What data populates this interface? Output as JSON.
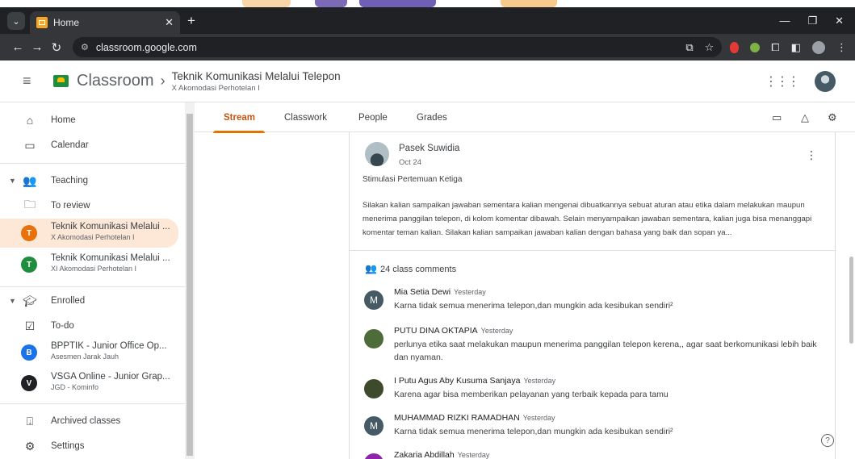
{
  "browser": {
    "tab_title": "Home",
    "url": "classroom.google.com"
  },
  "header": {
    "app_name": "Classroom",
    "class_name": "Teknik Komunikasi Melalui Telepon",
    "class_section": "X Akomodasi Perhotelan I"
  },
  "sidebar": {
    "home": "Home",
    "calendar": "Calendar",
    "teaching": "Teaching",
    "to_review": "To review",
    "teaching_classes": [
      {
        "initial": "T",
        "name": "Teknik Komunikasi Melalui ...",
        "section": "X Akomodasi Perhotelan I",
        "color": "#e8710a"
      },
      {
        "initial": "T",
        "name": "Teknik Komunikasi Melalui ...",
        "section": "XI Akomodasi Perhotelan I",
        "color": "#1e8e3e"
      }
    ],
    "enrolled": "Enrolled",
    "to_do": "To-do",
    "enrolled_classes": [
      {
        "initial": "B",
        "name": "BPPTIK - Junior Office Op...",
        "section": "Asesmen Jarak Jauh",
        "color": "#1a73e8"
      },
      {
        "initial": "V",
        "name": "VSGA Online - Junior Grap...",
        "section": "JGD - Kominfo",
        "color": "#202124"
      }
    ],
    "archived": "Archived classes",
    "settings": "Settings"
  },
  "tabs": [
    "Stream",
    "Classwork",
    "People",
    "Grades"
  ],
  "post": {
    "author": "Pasek Suwidia",
    "date": "Oct 24",
    "title": "Stimulasi Pertemuan Ketiga",
    "body": "Silakan kalian sampaikan jawaban sementara kalian mengenai dibuatkannya sebuat aturan atau etika dalam melakukan maupun menerima panggilan telepon, di kolom komentar dibawah. Selain menyampaikan jawaban sementara, kalian juga bisa menanggapi komentar teman kalian. Silakan kalian sampaikan jawaban kalian dengan bahasa yang baik dan sopan ya...",
    "comments_label": "24 class comments"
  },
  "comments": [
    {
      "initial": "M",
      "avatar_color": "#455a64",
      "name": "Mia Setia Dewi",
      "time": "Yesterday",
      "text": "Karna tidak semua menerima telepon,dan mungkin ada kesibukan sendiri²"
    },
    {
      "initial": "",
      "avatar_color": "#4e6b3a",
      "name": "PUTU DINA OKTAPIA",
      "time": "Yesterday",
      "text": "perlunya etika saat melakukan maupun menerima panggilan telepon kerena,, agar saat berkomunikasi lebih baik dan nyaman."
    },
    {
      "initial": "",
      "avatar_color": "#3e4a2c",
      "name": "I Putu Agus Aby Kusuma Sanjaya",
      "time": "Yesterday",
      "text": "Karena agar bisa memberikan pelayanan yang terbaik kepada para tamu"
    },
    {
      "initial": "M",
      "avatar_color": "#455a64",
      "name": "MUHAMMAD RIZKI RAMADHAN",
      "time": "Yesterday",
      "text": "Karna tidak semua menerima telepon,dan mungkin ada kesibukan sendiri²"
    },
    {
      "initial": "",
      "avatar_color": "#8e24aa",
      "name": "Zakaria Abdillah",
      "time": "Yesterday",
      "text": ""
    }
  ]
}
